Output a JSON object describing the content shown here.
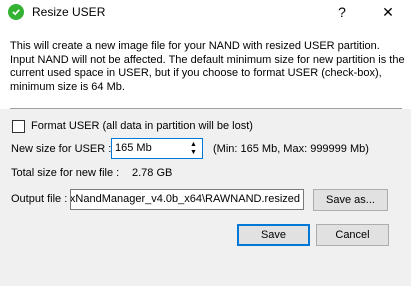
{
  "window": {
    "title": "Resize USER",
    "help_glyph": "?",
    "close_glyph": "✕",
    "icon": "green-shield-check-icon"
  },
  "description": "This will create a new image file for your NAND with resized USER partition. Input NAND will not be affected. The default minimum size for new partition is the current used space in USER, but if you choose to format USER (check-box), minimum size is 64 Mb.",
  "format_user": {
    "checked": false,
    "label": "Format USER (all data in partition will be lost)"
  },
  "new_size": {
    "label": "New size for USER :",
    "value": "165 Mb",
    "range_text": "(Min: 165 Mb, Max: 999999 Mb)"
  },
  "total_size": {
    "label": "Total size for new file :",
    "value": "2.78 GB"
  },
  "output": {
    "label": "Output file :",
    "value": "xNandManager_v4.0b_x64\\RAWNAND.resized"
  },
  "buttons": {
    "save_as": "Save as...",
    "save": "Save",
    "cancel": "Cancel"
  }
}
